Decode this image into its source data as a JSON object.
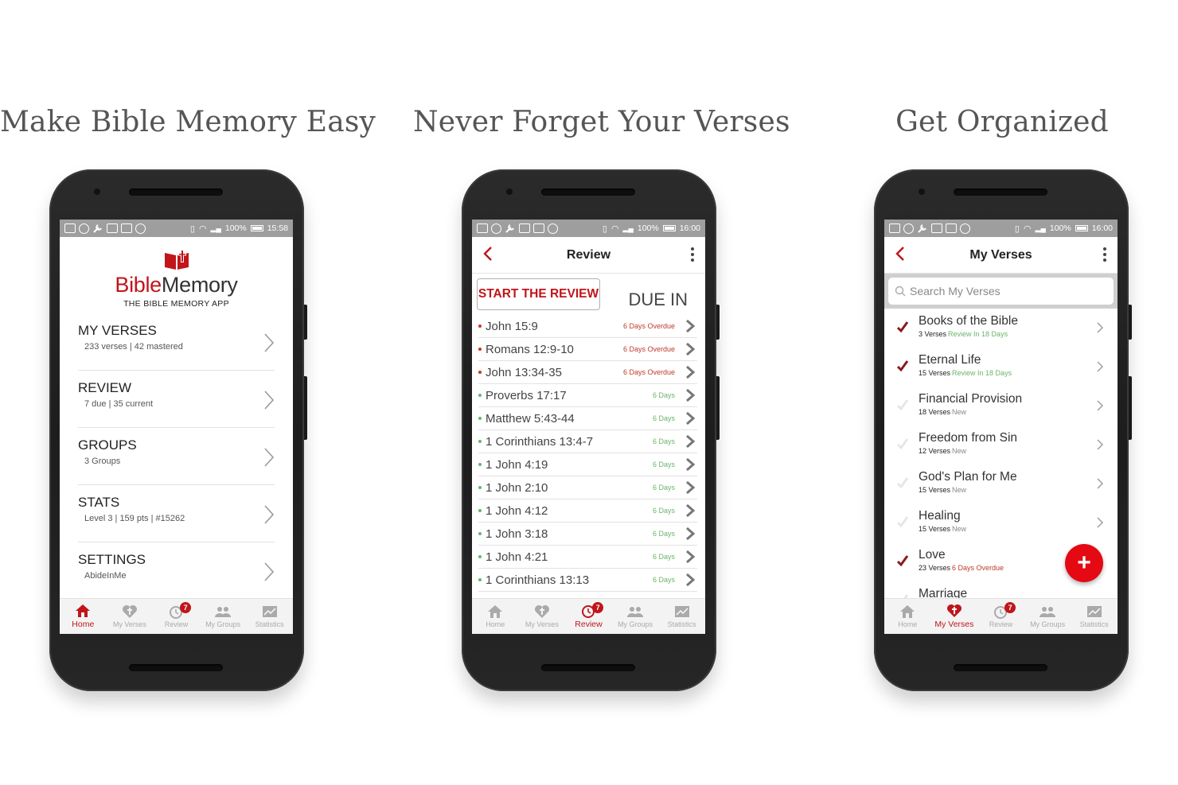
{
  "panels": [
    {
      "title": "Make Bible Memory Easy"
    },
    {
      "title": "Never Forget Your Verses"
    },
    {
      "title": "Get Organized"
    }
  ],
  "colors": {
    "accent": "#c0151b",
    "overdue": "#c0392b",
    "ok": "#6ab46a",
    "fab": "#e50914"
  },
  "status": {
    "battery": "100%",
    "time_home": "15:58",
    "time_review": "16:00",
    "time_verses": "16:00"
  },
  "home": {
    "logo_bible": "Bible",
    "logo_memory": "Memory",
    "logo_sub": "THE BIBLE MEMORY APP",
    "items": [
      {
        "title": "MY VERSES",
        "sub": "233 verses | 42 mastered"
      },
      {
        "title": "REVIEW",
        "sub": "7 due | 35 current"
      },
      {
        "title": "GROUPS",
        "sub": "3 Groups"
      },
      {
        "title": "STATS",
        "sub": "Level 3 | 159 pts | #15262"
      },
      {
        "title": "SETTINGS",
        "sub": "AbideInMe"
      }
    ]
  },
  "nav": {
    "home": "Home",
    "my_verses": "My Verses",
    "review": "Review",
    "my_groups": "My Groups",
    "statistics": "Statistics",
    "review_badge": "7"
  },
  "review": {
    "title": "Review",
    "start_label": "START THE REVIEW",
    "due_in_label": "DUE IN",
    "rows": [
      {
        "ref": "John 15:9",
        "due": "6 Days Overdue",
        "overdue": true
      },
      {
        "ref": "Romans 12:9-10",
        "due": "6 Days Overdue",
        "overdue": true
      },
      {
        "ref": "John 13:34-35",
        "due": "6 Days Overdue",
        "overdue": true
      },
      {
        "ref": "Proverbs 17:17",
        "due": "6 Days",
        "overdue": false
      },
      {
        "ref": "Matthew 5:43-44",
        "due": "6 Days",
        "overdue": false
      },
      {
        "ref": "1 Corinthians 13:4-7",
        "due": "6 Days",
        "overdue": false
      },
      {
        "ref": "1 John 4:19",
        "due": "6 Days",
        "overdue": false
      },
      {
        "ref": "1 John 2:10",
        "due": "6 Days",
        "overdue": false
      },
      {
        "ref": "1 John 4:12",
        "due": "6 Days",
        "overdue": false
      },
      {
        "ref": "1 John 3:18",
        "due": "6 Days",
        "overdue": false
      },
      {
        "ref": "1 John 4:21",
        "due": "6 Days",
        "overdue": false
      },
      {
        "ref": "1 Corinthians 13:13",
        "due": "6 Days",
        "overdue": false
      }
    ]
  },
  "my_verses": {
    "title": "My Verses",
    "search_placeholder": "Search My Verses",
    "rows": [
      {
        "title": "Books of the Bible",
        "count": "3 Verses",
        "status": "Review In 18 Days",
        "status_type": "ok",
        "checked": true
      },
      {
        "title": "Eternal Life",
        "count": "15 Verses",
        "status": "Review In 18 Days",
        "status_type": "ok",
        "checked": true
      },
      {
        "title": "Financial Provision",
        "count": "18 Verses",
        "status": "New",
        "status_type": "new",
        "checked": false
      },
      {
        "title": "Freedom from Sin",
        "count": "12 Verses",
        "status": "New",
        "status_type": "new",
        "checked": false
      },
      {
        "title": "God's Plan for Me",
        "count": "15 Verses",
        "status": "New",
        "status_type": "new",
        "checked": false
      },
      {
        "title": "Healing",
        "count": "15 Verses",
        "status": "New",
        "status_type": "new",
        "checked": false
      },
      {
        "title": "Love",
        "count": "23 Verses",
        "status": "6 Days Overdue",
        "status_type": "overdue",
        "checked": true
      },
      {
        "title": "Marriage",
        "count": "",
        "status": "",
        "status_type": "new",
        "checked": false
      }
    ],
    "fab_label": "+"
  }
}
